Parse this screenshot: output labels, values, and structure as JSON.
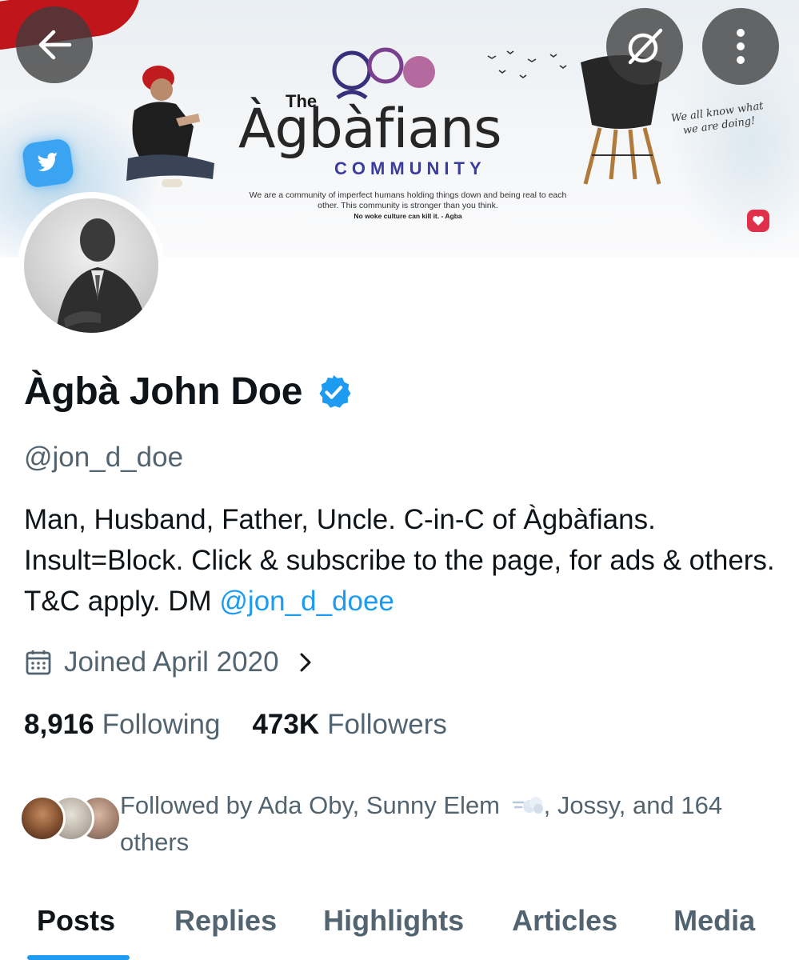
{
  "nav": {
    "back_icon": "arrow-left-icon",
    "grok_icon": "grok-icon",
    "more_icon": "more-vertical-icon"
  },
  "banner": {
    "logo_the": "The",
    "logo_title": "Àgbàfians",
    "logo_sub": "COMMUNITY",
    "tagline": "We are a community of imperfect humans holding things down and being real to each other. This community is stronger than you think.",
    "tagline_bold": "No woke culture can kill it.   - Agba",
    "script_text": "We all know what we are doing!"
  },
  "profile": {
    "display_name": "Àgbà John Doe",
    "handle": "@jon_d_doe",
    "bio_text": "Man, Husband, Father, Uncle. C-in-C of Àgbàfians. Insult=Block. Click & subscribe to the page, for ads & others. T&C apply.  DM ",
    "bio_mention": "@jon_d_doee",
    "joined": "Joined April 2020",
    "following_count": "8,916",
    "following_label": "Following",
    "followers_count": "473K",
    "followers_label": "Followers",
    "followed_by_prefix": "Followed by Ada Oby, Sunny Elem ",
    "followed_by_suffix": ", Jossy, and 164 others"
  },
  "tabs": [
    {
      "label": "Posts",
      "active": true
    },
    {
      "label": "Replies",
      "active": false
    },
    {
      "label": "Highlights",
      "active": false
    },
    {
      "label": "Articles",
      "active": false
    },
    {
      "label": "Media",
      "active": false
    }
  ],
  "colors": {
    "accent": "#1d9bf0",
    "secondary_text": "#536471",
    "primary_text": "#0f1419"
  }
}
